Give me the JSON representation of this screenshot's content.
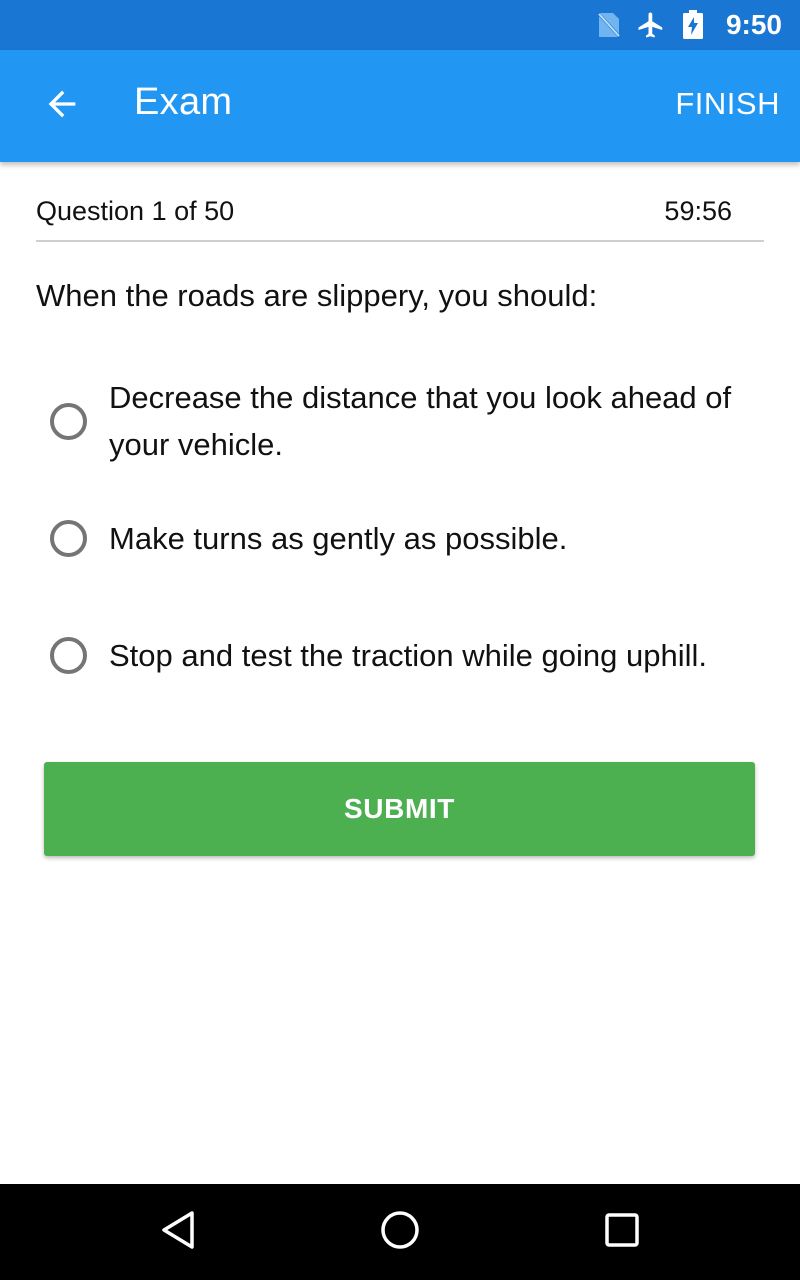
{
  "status_bar": {
    "time": "9:50",
    "icons": [
      "no-sim-icon",
      "airplane-mode-icon",
      "battery-charging-icon"
    ]
  },
  "app_bar": {
    "back_icon": "arrow-back-icon",
    "title": "Exam",
    "finish_label": "FINISH"
  },
  "exam": {
    "question_counter": "Question 1 of 50",
    "timer": "59:56",
    "question": "When the roads are slippery, you should:",
    "options": [
      {
        "label": "Decrease the distance that you look ahead of your vehicle.",
        "selected": false
      },
      {
        "label": "Make turns as gently as possible.",
        "selected": false
      },
      {
        "label": "Stop and test the traction while going uphill.",
        "selected": false
      }
    ],
    "submit_label": "SUBMIT"
  },
  "nav_bar": {
    "icons": [
      "nav-back-icon",
      "nav-home-icon",
      "nav-recents-icon"
    ]
  },
  "colors": {
    "status_bar": "#1976D2",
    "app_bar": "#2196F3",
    "submit": "#4CAF50",
    "radio": "#757575"
  }
}
